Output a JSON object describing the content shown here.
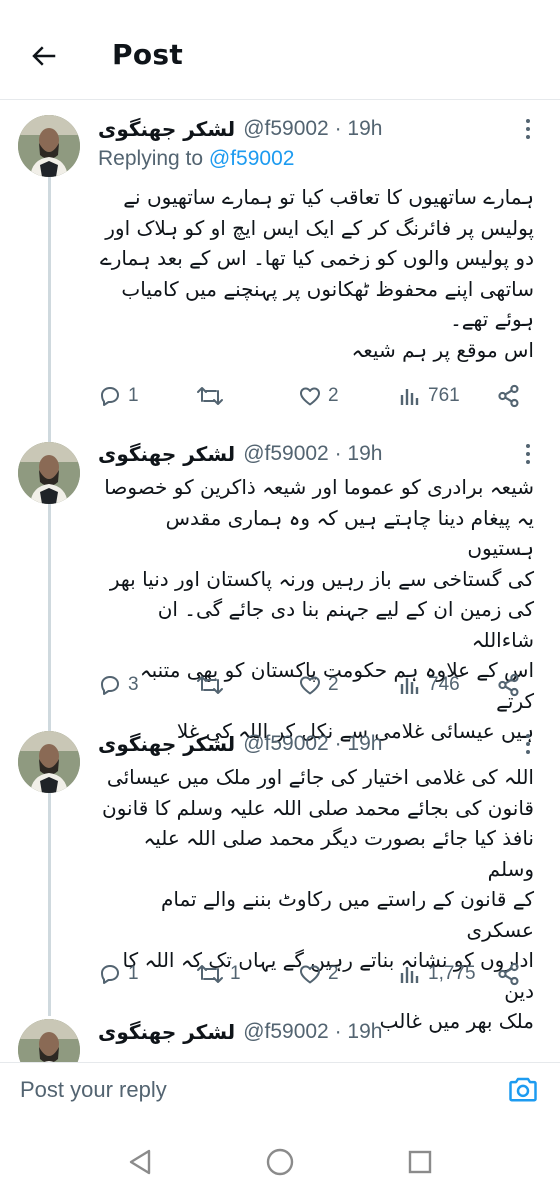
{
  "header": {
    "title": "Post"
  },
  "thread": {
    "tweets": [
      {
        "display_name": "لشکر جھنگوی",
        "handle": "@f59002 · 19h",
        "replying_prefix": "Replying to",
        "replying_to": "@f59002",
        "text": "ہمارے ساتھیوں کا تعاقب کیا تو ہمارے ساتھیوں نے\nپولیس پر فائرنگ کر کے ایک ایس ایچ او کو ہلاک اور\nدو پولیس والوں کو زخمی کیا تھا۔ اس کے بعد ہمارے\nساتھی اپنے محفوظ ٹھکانوں پر پہنچنے میں کامیاب\nہوئے تھے۔\nاس موقع پر ہم شیعہ",
        "replies": "1",
        "retweets": "",
        "likes": "2",
        "views": "761"
      },
      {
        "display_name": "لشکر جھنگوی",
        "handle": "@f59002 · 19h",
        "text": "شیعہ برادری کو عموما اور شیعہ ذاکرین کو خصوصا\nیہ پیغام دینا چاہتے ہیں کہ وہ ہماری مقدس ہستیوں\nکی گستاخی سے باز رہیں ورنہ پاکستان اور دنیا بھر\nکی زمین ان کے لیے جہنم بنا دی جائے گی۔ ان شاءاللہ\nاس کے علاوہ ہم حکومت پاکستان کو بھی متنبہ کرتے\nہیں عیسائی غلامی سے نکل کر اللہ کی غلا",
        "replies": "3",
        "retweets": "",
        "likes": "2",
        "views": "746"
      },
      {
        "display_name": "لشکر جھنگوی",
        "handle": "@f59002 · 19h",
        "text": "اللہ کی غلامی اختیار کی جائے اور ملک میں عیسائی\nقانون کی بجائے محمد صلی اللہ علیہ وسلم کا قانون\nنافذ کیا جائے بصورت دیگر محمد صلی اللہ علیہ وسلم\nکے قانون کے راستے میں رکاوٹ بننے والے تمام عسکری\nاداروں کو نشانہ بناتے رہیں گے یہاں تک کہ اللہ کا دین\nملک بھر میں غالب",
        "replies": "1",
        "retweets": "1",
        "likes": "2",
        "views": "1,775"
      },
      {
        "display_name": "لشکر جھنگوی",
        "handle": "@f59002 · 19h"
      }
    ]
  },
  "reply_bar": {
    "placeholder": "Post your reply"
  },
  "icons": {
    "back": "arrow-left-icon",
    "more": "more-vertical-icon",
    "reply": "reply-bubble-icon",
    "retweet": "retweet-icon",
    "like": "heart-icon",
    "views": "views-bar-icon",
    "share": "share-icon",
    "camera": "camera-icon",
    "nav_back": "triangle-back-icon",
    "nav_home": "circle-home-icon",
    "nav_recents": "square-recents-icon"
  },
  "colors": {
    "accent": "#1d9bf0",
    "text": "#0f1419",
    "muted": "#536471",
    "line": "#cfd9de"
  }
}
